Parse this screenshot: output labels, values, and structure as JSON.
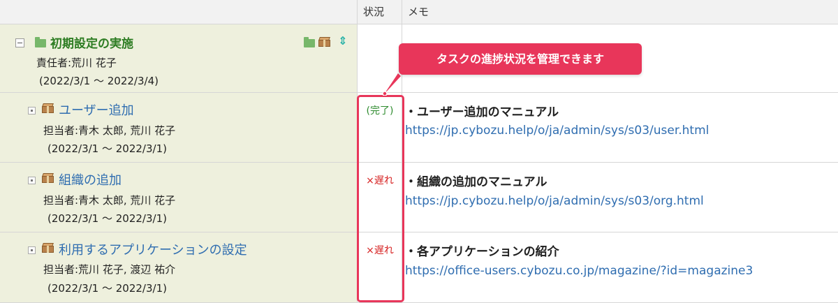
{
  "header": {
    "task_col": "",
    "status_col": "状況",
    "memo_col": "メモ"
  },
  "project": {
    "name": "初期設定の実施",
    "owner_label": "責任者:荒川 花子",
    "period": "(2022/3/1 〜 2022/3/4)"
  },
  "tasks": [
    {
      "name": "ユーザー追加",
      "assignees": "担当者:青木 太郎, 荒川 花子",
      "period": "(2022/3/1 〜 2022/3/1)",
      "status": "(完了)",
      "memo_title": "・ユーザー追加のマニュアル",
      "memo_link": "https://jp.cybozu.help/o/ja/admin/sys/s03/user.html"
    },
    {
      "name": "組織の追加",
      "assignees": "担当者:青木 太郎, 荒川 花子",
      "period": "(2022/3/1 〜 2022/3/1)",
      "status": "×遅れ",
      "memo_title": "・組織の追加のマニュアル",
      "memo_link": "https://jp.cybozu.help/o/ja/admin/sys/s03/org.html"
    },
    {
      "name": "利用するアプリケーションの設定",
      "assignees": "担当者:荒川 花子, 渡辺 祐介",
      "period": "(2022/3/1 〜 2022/3/1)",
      "status": "×遅れ",
      "memo_title": "・各アプリケーションの紹介",
      "memo_link": "https://office-users.cybozu.co.jp/magazine/?id=magazine3"
    }
  ],
  "callout": {
    "text": "タスクの進捗状況を管理できます"
  },
  "colors": {
    "accent": "#e8365a",
    "task_bg": "#eef0dd",
    "link": "#2f6db0",
    "project_title": "#2e7d23",
    "status_done": "#2e8b2e",
    "status_late": "#d62020"
  },
  "icons": [
    "collapse-icon",
    "folder-icon",
    "package-icon",
    "move-arrows-icon",
    "task-toggle-icon"
  ]
}
